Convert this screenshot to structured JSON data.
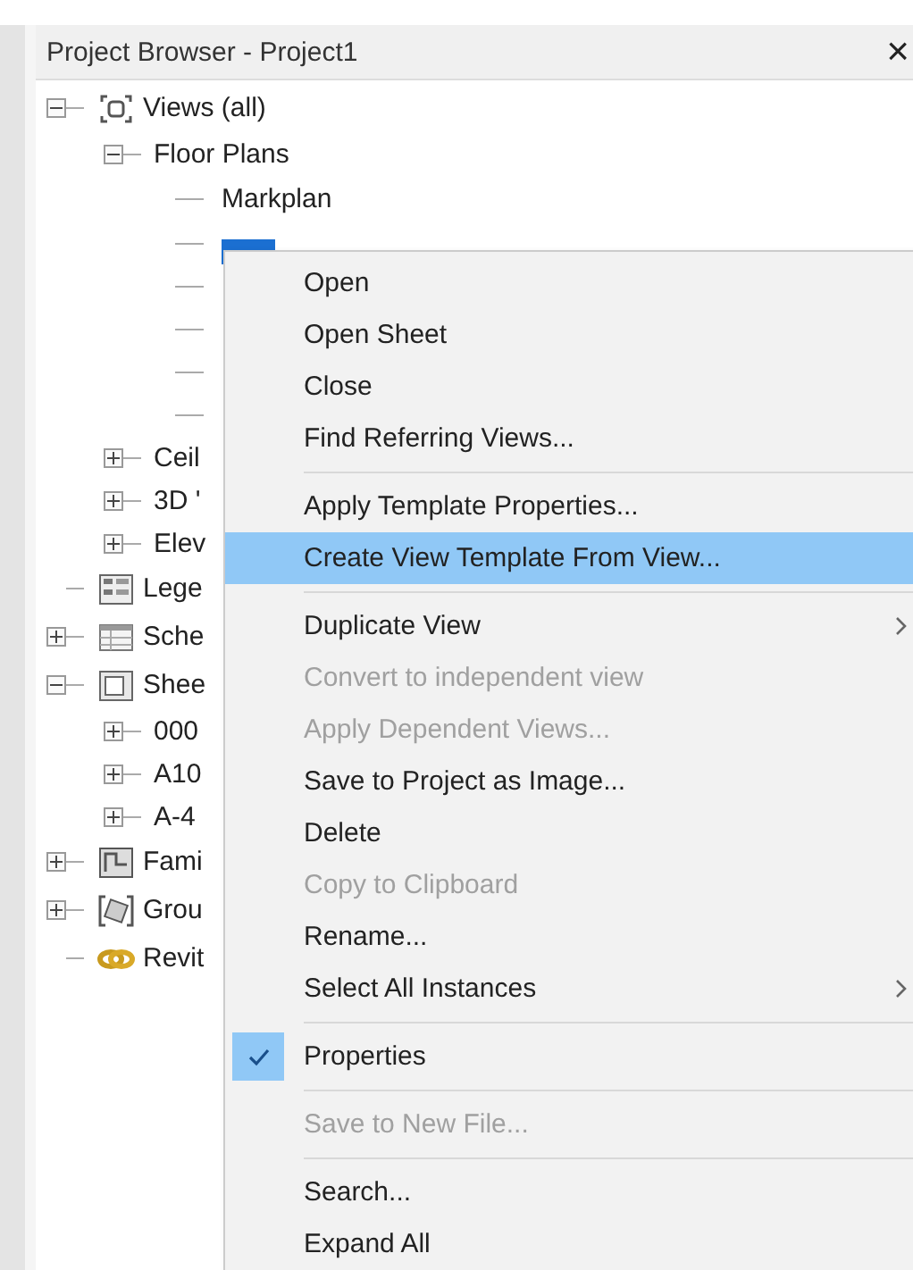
{
  "window": {
    "title": "Project Browser - Project1",
    "close": "×"
  },
  "tree": [
    {
      "label": "Views (all)",
      "kind": "views",
      "expanded": true,
      "children": [
        {
          "label": "Floor Plans",
          "kind": "folder",
          "expanded": true,
          "children": [
            {
              "label": "Markplan",
              "kind": "leaf",
              "selected": false
            },
            {
              "kind": "leaf",
              "selected": true
            },
            {
              "kind": "leaf"
            },
            {
              "kind": "leaf"
            },
            {
              "kind": "leaf"
            },
            {
              "kind": "leaf"
            }
          ]
        },
        {
          "label": "Ceil",
          "kind": "folder",
          "expanded": false
        },
        {
          "label": "3D '",
          "kind": "folder",
          "expanded": false
        },
        {
          "label": "Elev",
          "kind": "folder",
          "expanded": false
        }
      ]
    },
    {
      "label": "Lege",
      "kind": "legends"
    },
    {
      "label": "Sche",
      "kind": "schedules",
      "expanded": false
    },
    {
      "label": "Shee",
      "kind": "sheets",
      "expanded": true,
      "children": [
        {
          "label": "000",
          "kind": "folder",
          "expanded": false
        },
        {
          "label": "A10",
          "kind": "folder",
          "expanded": false
        },
        {
          "label": "A-4",
          "kind": "folder",
          "expanded": false
        }
      ]
    },
    {
      "label": "Fami",
      "kind": "families",
      "expanded": false
    },
    {
      "label": "Grou",
      "kind": "groups",
      "expanded": false
    },
    {
      "label": "Revit",
      "kind": "links"
    }
  ],
  "menu": [
    {
      "kind": "item",
      "label": "Open",
      "disabled": false,
      "selected": false
    },
    {
      "kind": "item",
      "label": "Open Sheet",
      "disabled": false,
      "selected": false
    },
    {
      "kind": "item",
      "label": "Close",
      "disabled": false,
      "selected": false
    },
    {
      "kind": "item",
      "label": "Find Referring Views...",
      "disabled": false,
      "selected": false
    },
    {
      "kind": "separator"
    },
    {
      "kind": "item",
      "label": "Apply Template Properties...",
      "disabled": false,
      "selected": false
    },
    {
      "kind": "item",
      "label": "Create View Template From View...",
      "disabled": false,
      "selected": true
    },
    {
      "kind": "separator"
    },
    {
      "kind": "item",
      "label": "Duplicate View",
      "disabled": false,
      "selected": false,
      "submenu": true
    },
    {
      "kind": "item",
      "label": "Convert to independent view",
      "disabled": true,
      "selected": false
    },
    {
      "kind": "item",
      "label": "Apply Dependent Views...",
      "disabled": true,
      "selected": false
    },
    {
      "kind": "item",
      "label": "Save to Project as Image...",
      "disabled": false,
      "selected": false
    },
    {
      "kind": "item",
      "label": "Delete",
      "disabled": false,
      "selected": false
    },
    {
      "kind": "item",
      "label": "Copy to Clipboard",
      "disabled": true,
      "selected": false
    },
    {
      "kind": "item",
      "label": "Rename...",
      "disabled": false,
      "selected": false
    },
    {
      "kind": "item",
      "label": "Select All Instances",
      "disabled": false,
      "selected": false,
      "submenu": true
    },
    {
      "kind": "separator"
    },
    {
      "kind": "item",
      "label": "Properties",
      "disabled": false,
      "selected": false,
      "checked": true
    },
    {
      "kind": "separator"
    },
    {
      "kind": "item",
      "label": "Save to New File...",
      "disabled": true,
      "selected": false
    },
    {
      "kind": "separator"
    },
    {
      "kind": "item",
      "label": "Search...",
      "disabled": false,
      "selected": false
    },
    {
      "kind": "item",
      "label": "Expand All",
      "disabled": false,
      "selected": false
    }
  ]
}
